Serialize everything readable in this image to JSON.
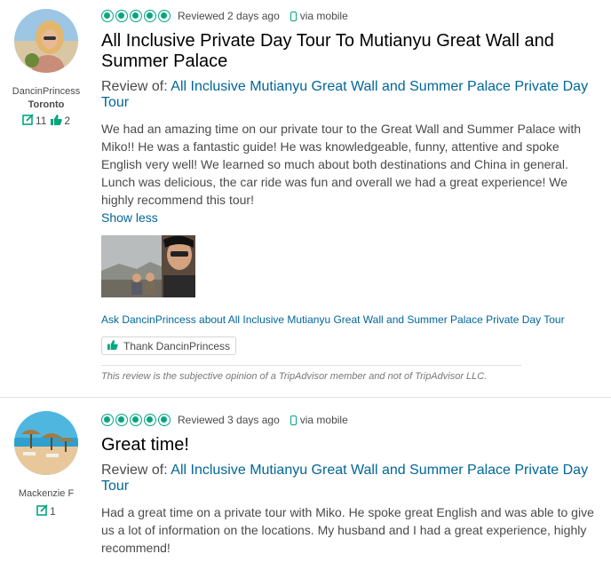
{
  "reviews": [
    {
      "member": {
        "username": "DancinPrincess",
        "location": "Toronto",
        "contributions": "11",
        "helpful_votes": "2"
      },
      "rating_bubbles": 5,
      "reviewed_text": "Reviewed 2 days ago",
      "via_mobile": "via mobile",
      "title": "All Inclusive Private Day Tour To Mutianyu Great Wall and Summer Palace",
      "review_of_prefix": "Review of:",
      "review_of_link": "All Inclusive Mutianyu Great Wall and Summer Palace Private Day Tour",
      "body": "We had an amazing time on our private tour to the Great Wall and Summer Palace with Miko!! He was a fantastic guide! He was knowledgeable, funny, attentive and spoke English very well! We learned so much about both destinations and China in general. Lunch was delicious, the car ride was fun and overall we had a great experience! We highly recommend this tour!",
      "show_less": "Show less",
      "ask_link": "Ask DancinPrincess about All Inclusive Mutianyu Great Wall and Summer Palace Private Day Tour",
      "thank_label": "Thank DancinPrincess",
      "disclaimer": "This review is the subjective opinion of a TripAdvisor member and not of TripAdvisor LLC."
    },
    {
      "member": {
        "username": "Mackenzie F",
        "contributions": "1"
      },
      "rating_bubbles": 5,
      "reviewed_text": "Reviewed 3 days ago",
      "via_mobile": "via mobile",
      "title": "Great time!",
      "review_of_prefix": "Review of:",
      "review_of_link": "All Inclusive Mutianyu Great Wall and Summer Palace Private Day Tour",
      "body": "Had a great time on a private tour with Miko. He spoke great English and was able to give us a lot of information on the locations. My husband and I had a great experience, highly recommend!"
    }
  ],
  "colors": {
    "accent_green": "#00a680",
    "link_blue": "#006699",
    "text": "#4a4a4a"
  },
  "icons": [
    "review-count-icon",
    "thumbs-up-icon",
    "rating-bubble-icon",
    "mobile-phone-icon"
  ]
}
